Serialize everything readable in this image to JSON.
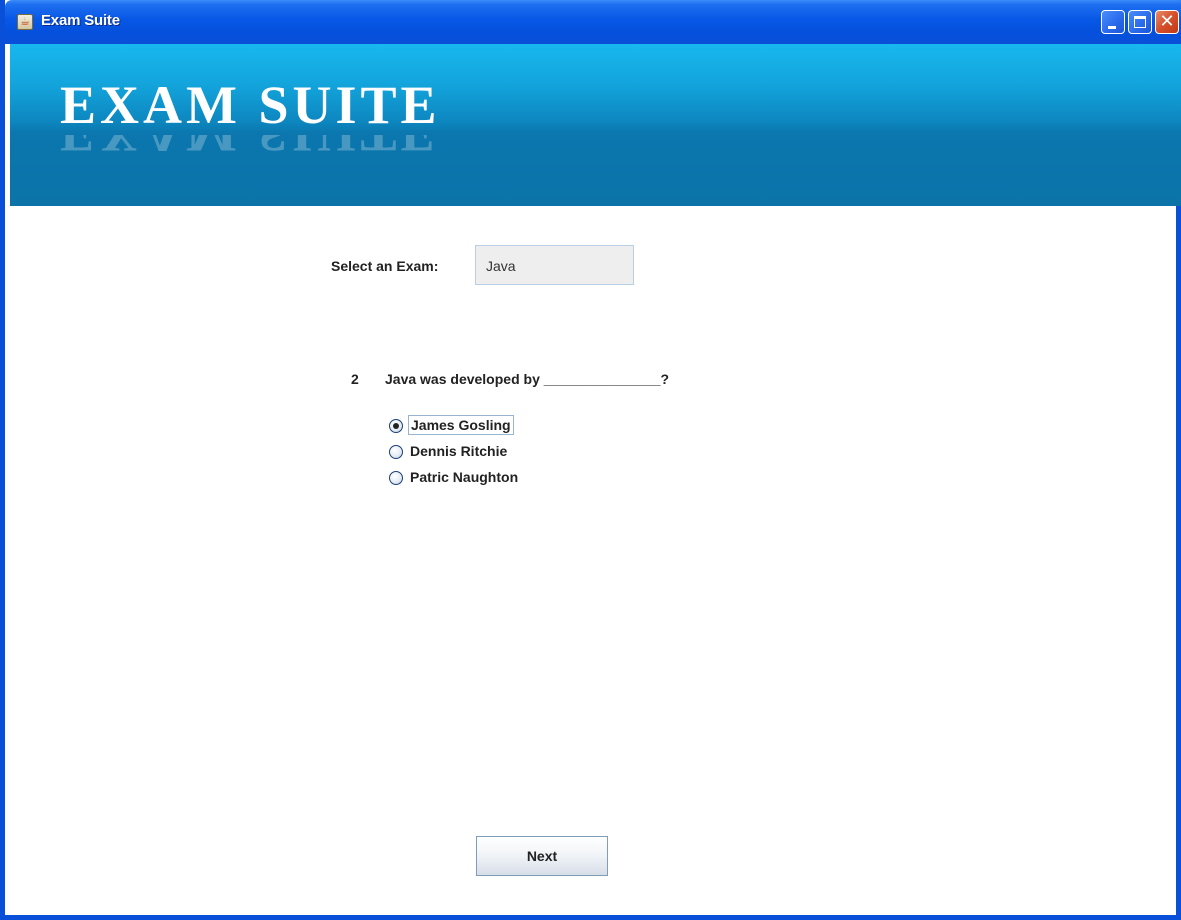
{
  "window": {
    "title": "Exam Suite",
    "icon": "java-cup-icon",
    "controls": {
      "minimize": "minimize-icon",
      "maximize": "maximize-icon",
      "close": "close-icon"
    }
  },
  "banner": {
    "title": "EXAM SUITE"
  },
  "exam_selector": {
    "label": "Select an Exam:",
    "value": "Java"
  },
  "question": {
    "number": "2",
    "text": "Java was developed by _______________?",
    "options": [
      {
        "label": "James Gosling",
        "selected": true
      },
      {
        "label": "Dennis Ritchie",
        "selected": false
      },
      {
        "label": "Patric Naughton",
        "selected": false
      }
    ]
  },
  "actions": {
    "next_label": "Next"
  },
  "colors": {
    "titlebar": "#0757e6",
    "banner_top": "#17b8ee",
    "banner_bottom": "#0b73a8",
    "field_background": "#eeeeee"
  }
}
